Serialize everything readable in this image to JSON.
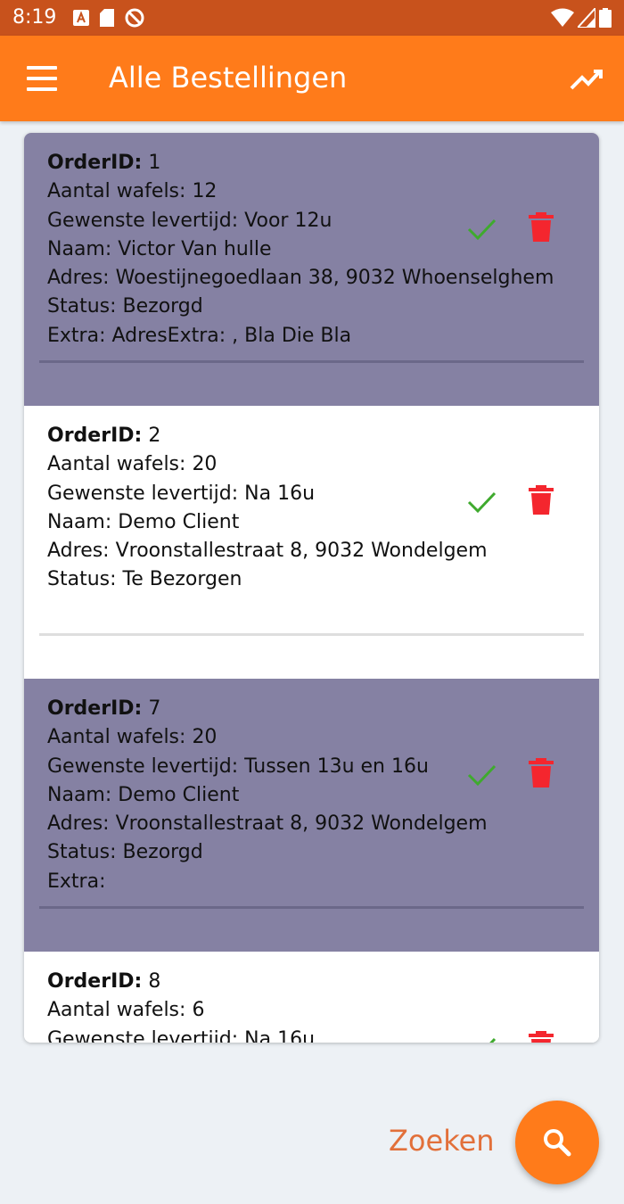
{
  "status_bar": {
    "time": "8:19",
    "left_icons": [
      "a-badge-icon",
      "sd-card-icon",
      "do-not-disturb-icon"
    ],
    "right_icons": [
      "wifi-icon",
      "signal-icon",
      "battery-icon"
    ]
  },
  "app_bar": {
    "title": "Alle Bestellingen",
    "menu_icon": "menu-icon",
    "action_icon": "trending-up-icon",
    "color": "#ff7b1a"
  },
  "labels": {
    "order_id": "OrderID:",
    "quantity": "Aantal wafels:",
    "delivery_time": "Gewenste levertijd:",
    "name": "Naam:",
    "address": "Adres:",
    "status": "Status:",
    "extra": "Extra:"
  },
  "orders": [
    {
      "id": "1",
      "quantity": "12",
      "delivery_time": "Voor 12u",
      "name": "Victor Van hulle",
      "address": "Woestijnegoedlaan 38, 9032 Whoenselghem",
      "status": "Bezorgd",
      "extra": "AdresExtra: , Bla Die Bla"
    },
    {
      "id": "2",
      "quantity": "20",
      "delivery_time": "Na 16u",
      "name": "Demo Client",
      "address": "Vroonstallestraat 8, 9032 Wondelgem",
      "status": "Te Bezorgen"
    },
    {
      "id": "7",
      "quantity": "20",
      "delivery_time": "Tussen 13u en 16u",
      "name": "Demo Client",
      "address": "Vroonstallestraat 8, 9032 Wondelgem",
      "status": "Bezorgd",
      "extra": ""
    },
    {
      "id": "8",
      "quantity": "6",
      "delivery_time": "Na 16u"
    }
  ],
  "colors": {
    "delivered_background": "#8581a3",
    "check_icon": "#3faa2e",
    "delete_icon": "#f4262e"
  },
  "search": {
    "label": "Zoeken",
    "icon": "search-icon"
  }
}
